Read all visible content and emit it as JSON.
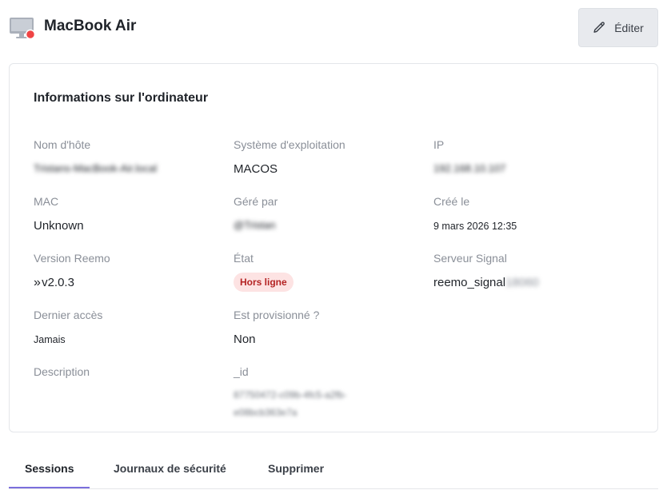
{
  "header": {
    "title": "MacBook Air",
    "edit_label": "Éditer",
    "status_dot_color": "#ef4444"
  },
  "card": {
    "title": "Informations sur l'ordinateur",
    "hostname": {
      "label": "Nom d'hôte",
      "value": "Tristans-MacBook-Air.local"
    },
    "os": {
      "label": "Système d'exploitation",
      "value": "MACOS"
    },
    "ip": {
      "label": "IP",
      "value": "192.168.10.107"
    },
    "mac": {
      "label": "MAC",
      "value": "Unknown"
    },
    "managed_by": {
      "label": "Géré par",
      "value": "@Tristan"
    },
    "created": {
      "label": "Créé le",
      "value": "9 mars 2026 12:35"
    },
    "version": {
      "label": "Version Reemo",
      "value": "v2.0.3",
      "chevron": "»"
    },
    "state": {
      "label": "État",
      "value": "Hors ligne"
    },
    "signal": {
      "label": "Serveur Signal",
      "value": "reemo_signal",
      "suffix": "18060"
    },
    "last_access": {
      "label": "Dernier accès",
      "value": "Jamais"
    },
    "provisioned": {
      "label": "Est provisionné ?",
      "value": "Non"
    },
    "description": {
      "label": "Description"
    },
    "id": {
      "label": "_id",
      "value": "87750472-c09b-4fc5-a2fb-e08bcb363e7a"
    }
  },
  "tabs": [
    {
      "label": "Sessions",
      "active": true
    },
    {
      "label": "Journaux de sécurité",
      "active": false
    },
    {
      "label": "Supprimer",
      "active": false
    }
  ]
}
